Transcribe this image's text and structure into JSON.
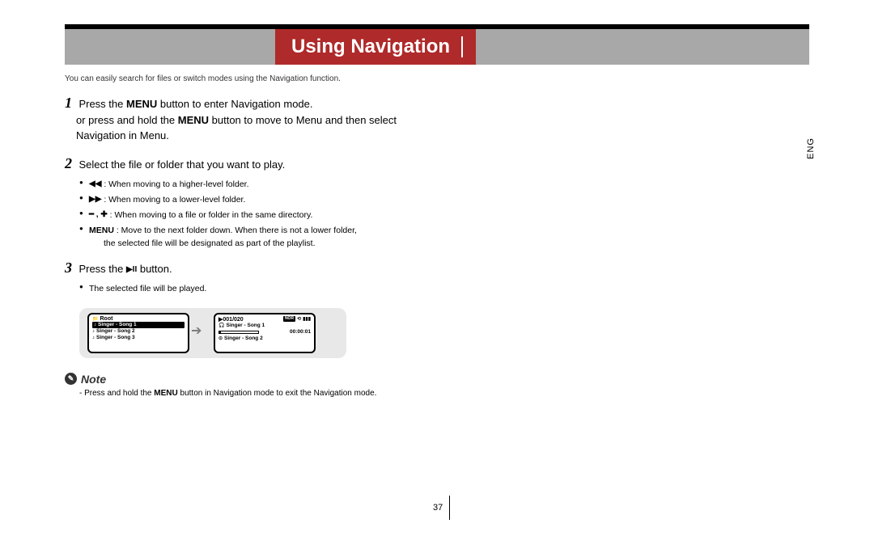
{
  "header": {
    "title": "Using Navigation"
  },
  "lang": "ENG",
  "intro": "You can easily search for files or switch modes using the Navigation function.",
  "steps": {
    "s1": {
      "num": "1",
      "line1a": " Press the ",
      "bold1": "MENU",
      "line1b": " button to enter Navigation mode.",
      "line2a": "or press and hold the ",
      "bold2": "MENU",
      "line2b": " button to move to Menu and then select",
      "line3": "Navigation in Menu."
    },
    "s2": {
      "num": "2",
      "text": " Select the file or folder that you want to play.",
      "b1_icon": "◀◀",
      "b1": ": When moving to a higher-level folder.",
      "b2_icon": "▶▶",
      "b2": ": When moving to a lower-level folder.",
      "b3_icon": "━ , ✚",
      "b3": ": When moving to a file or folder in the same directory.",
      "b4_bold": "MENU",
      "b4a": " : Move to the next folder down. When there is not a lower folder,",
      "b4b": "the selected file will be designated as part of the playlist."
    },
    "s3": {
      "num": "3",
      "text_a": " Press the ",
      "icon": "▶II",
      "text_b": " button.",
      "b1": "The selected file will be played."
    }
  },
  "screens": {
    "left": {
      "folder_icon": "📁",
      "title": "Root",
      "r1": "Singer - Song 1",
      "r2": "Singer - Song 2",
      "r3": "Singer - Song 3"
    },
    "right": {
      "track": "▶001/020",
      "badge1": "NOR",
      "r1": "Singer - Song 1",
      "time": "00:00:01",
      "r2": "Singer - Song 2"
    }
  },
  "note": {
    "label": "Note",
    "text_a": "- Press and hold the ",
    "bold": "MENU",
    "text_b": " button in Navigation mode to exit the Navigation mode."
  },
  "page_number": "37"
}
